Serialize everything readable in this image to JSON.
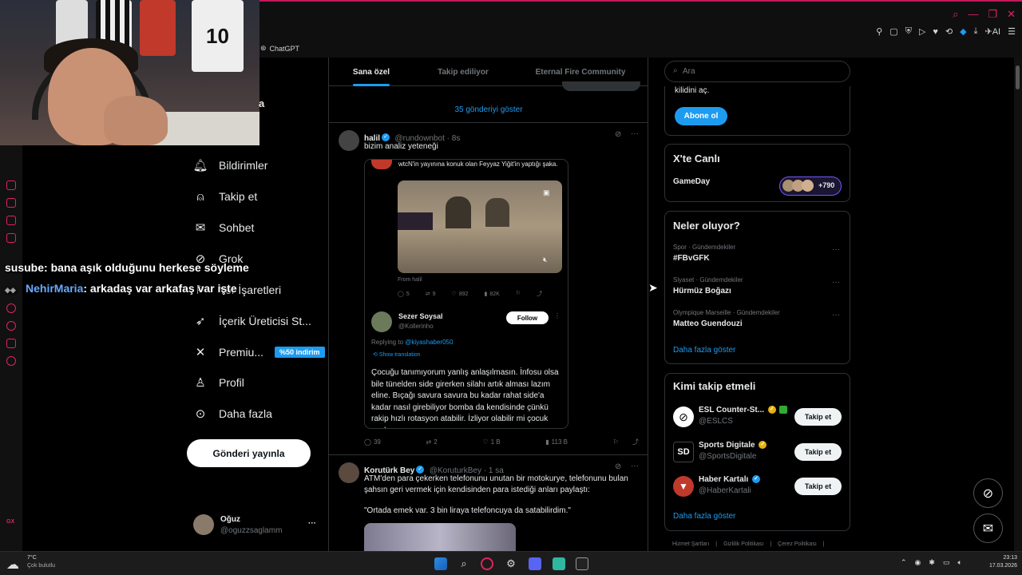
{
  "browser": {
    "bookmark": "ChatGPT",
    "ext_ai": "AI"
  },
  "nav": {
    "partial_logo_letter": "a",
    "items": [
      {
        "label": "Bildirimler",
        "icon": "bell-icon"
      },
      {
        "label": "Takip et",
        "icon": "person-plus-icon"
      },
      {
        "label": "Sohbet",
        "icon": "mail-icon"
      },
      {
        "label": "Grok",
        "icon": "grok-icon"
      },
      {
        "label": "Yer İşaretleri",
        "icon": "bookmark-icon"
      },
      {
        "label": "İçerik Üreticisi St...",
        "icon": "rocket-icon"
      },
      {
        "label": "Premiu...",
        "icon": "x-logo-icon"
      },
      {
        "label": "Profil",
        "icon": "person-icon"
      },
      {
        "label": "Daha fazla",
        "icon": "more-circle-icon"
      }
    ],
    "premium_badge": "%50 indirim",
    "post_button": "Gönderi yayınla",
    "account": {
      "name": "Oğuz",
      "handle": "@oguzzsaglamm",
      "more": "···"
    }
  },
  "chat": [
    {
      "user": "susube",
      "message": ": bana aşık olduğunu herkese söyleme",
      "color": "#ffffff"
    },
    {
      "user": "NehirMaria",
      "message": ": arkadaş var arkafaş var işte",
      "color": "#66aaff"
    }
  ],
  "feed": {
    "tabs": [
      "Sana özel",
      "Takip ediliyor",
      "Eternal Fire Community"
    ],
    "show_posts": "35 gönderiyi göster",
    "tweet1": {
      "name": "halil",
      "handle": "@rundownbot · 8s",
      "text": "bizim analiz yeteneği",
      "embed": {
        "top_text": "wtcN'in yayınına konuk olan Feyyaz Yiğit'in yaptığı şaka.",
        "from": "From halil",
        "stats": {
          "replies": "5",
          "reposts": "9",
          "likes": "892",
          "views": "82K"
        },
        "quoted_name": "Sezer Soysal",
        "quoted_handle": "@Kollerinho",
        "follow": "Follow",
        "replying_label": "Replying to",
        "replying_to": "@kiyashaber050",
        "show_translation": "Show translation",
        "body": "Çocuğu tanımıyorum yanlış anlaşılmasın. İnfosu olsa bile tünelden side girerken silahı artık alması lazım eline. Bıçağı savura savura bu kadar rahat side'a kadar nasıl girebiliyor bomba da kendisinde çünkü rakip hızlı rotasyon atabilir. İzliyor olabilir mi çocuk acaba"
      },
      "stats": {
        "replies": "39",
        "reposts": "2",
        "likes": "1 B",
        "views": "113 B"
      }
    },
    "tweet2": {
      "name": "Korutürk Bey",
      "handle": "@KoruturkBey · 1 sa",
      "text": "ATM'den para çekerken telefonunu unutan bir motokurye, telefonunu bulan şahsın geri vermek için kendisinden para istediği anları paylaştı:",
      "quote": "\"Ortada emek var. 3 bin liraya telefoncuya da satabilirdim.\""
    }
  },
  "right": {
    "search_placeholder": "Ara",
    "premium_text": "kilidini aç.",
    "subscribe": "Abone ol",
    "live_title": "X'te Canlı",
    "live_item": "GameDay",
    "live_count": "+790",
    "trends_title": "Neler oluyor?",
    "trends": [
      {
        "meta": "Spor · Gündemdekiler",
        "name": "#FBvGFK"
      },
      {
        "meta": "Siyaset · Gündemdekiler",
        "name": "Hürmüz Boğazı"
      },
      {
        "meta": "Olympique Marseille · Gündemdekiler",
        "name": "Matteo Guendouzi"
      }
    ],
    "show_more": "Daha fazla göster",
    "who_title": "Kimi takip etmeli",
    "who": [
      {
        "name": "ESL Counter-St...",
        "handle": "@ESLCS",
        "button": "Takip et"
      },
      {
        "name": "Sports Digitale",
        "handle": "@SportsDigitale",
        "button": "Takip et"
      },
      {
        "name": "Haber Kartalı",
        "handle": "@HaberKartali",
        "button": "Takip et"
      }
    ],
    "who_more": "Daha fazla göster",
    "footer": [
      "Hizmet Şartları",
      "Gizlilik Politikası",
      "Çerez Politikası"
    ]
  },
  "taskbar": {
    "weather_temp": "7°C",
    "weather_desc": "Çok bulutlu",
    "time": "23:13",
    "date": "17.03.2026"
  },
  "colors": {
    "accent": "#1d9bf0",
    "opera": "#e0245e",
    "background": "#000000"
  }
}
